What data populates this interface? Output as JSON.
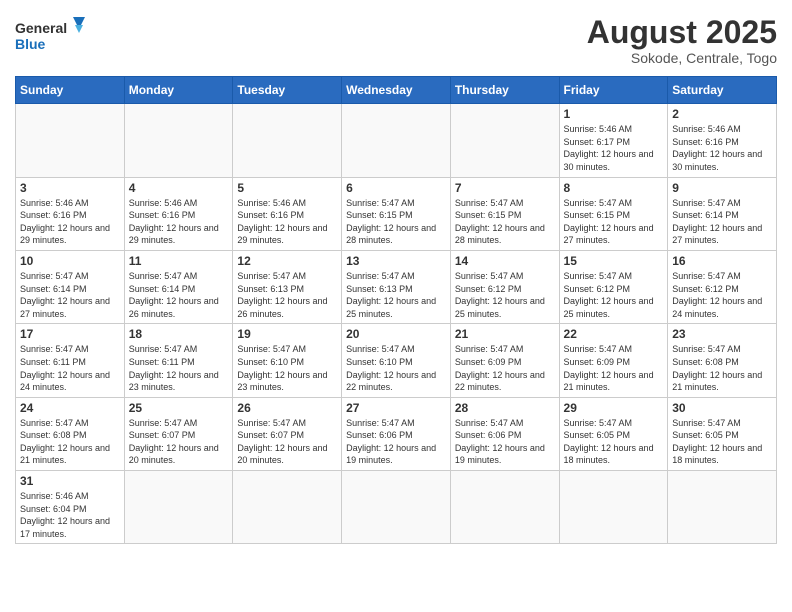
{
  "header": {
    "logo_general": "General",
    "logo_blue": "Blue",
    "main_title": "August 2025",
    "subtitle": "Sokode, Centrale, Togo"
  },
  "weekdays": [
    "Sunday",
    "Monday",
    "Tuesday",
    "Wednesday",
    "Thursday",
    "Friday",
    "Saturday"
  ],
  "days": [
    {
      "date": "",
      "info": ""
    },
    {
      "date": "",
      "info": ""
    },
    {
      "date": "",
      "info": ""
    },
    {
      "date": "",
      "info": ""
    },
    {
      "date": "",
      "info": ""
    },
    {
      "date": "1",
      "info": "Sunrise: 5:46 AM\nSunset: 6:17 PM\nDaylight: 12 hours and 30 minutes."
    },
    {
      "date": "2",
      "info": "Sunrise: 5:46 AM\nSunset: 6:16 PM\nDaylight: 12 hours and 30 minutes."
    },
    {
      "date": "3",
      "info": "Sunrise: 5:46 AM\nSunset: 6:16 PM\nDaylight: 12 hours and 29 minutes."
    },
    {
      "date": "4",
      "info": "Sunrise: 5:46 AM\nSunset: 6:16 PM\nDaylight: 12 hours and 29 minutes."
    },
    {
      "date": "5",
      "info": "Sunrise: 5:46 AM\nSunset: 6:16 PM\nDaylight: 12 hours and 29 minutes."
    },
    {
      "date": "6",
      "info": "Sunrise: 5:47 AM\nSunset: 6:15 PM\nDaylight: 12 hours and 28 minutes."
    },
    {
      "date": "7",
      "info": "Sunrise: 5:47 AM\nSunset: 6:15 PM\nDaylight: 12 hours and 28 minutes."
    },
    {
      "date": "8",
      "info": "Sunrise: 5:47 AM\nSunset: 6:15 PM\nDaylight: 12 hours and 27 minutes."
    },
    {
      "date": "9",
      "info": "Sunrise: 5:47 AM\nSunset: 6:14 PM\nDaylight: 12 hours and 27 minutes."
    },
    {
      "date": "10",
      "info": "Sunrise: 5:47 AM\nSunset: 6:14 PM\nDaylight: 12 hours and 27 minutes."
    },
    {
      "date": "11",
      "info": "Sunrise: 5:47 AM\nSunset: 6:14 PM\nDaylight: 12 hours and 26 minutes."
    },
    {
      "date": "12",
      "info": "Sunrise: 5:47 AM\nSunset: 6:13 PM\nDaylight: 12 hours and 26 minutes."
    },
    {
      "date": "13",
      "info": "Sunrise: 5:47 AM\nSunset: 6:13 PM\nDaylight: 12 hours and 25 minutes."
    },
    {
      "date": "14",
      "info": "Sunrise: 5:47 AM\nSunset: 6:12 PM\nDaylight: 12 hours and 25 minutes."
    },
    {
      "date": "15",
      "info": "Sunrise: 5:47 AM\nSunset: 6:12 PM\nDaylight: 12 hours and 25 minutes."
    },
    {
      "date": "16",
      "info": "Sunrise: 5:47 AM\nSunset: 6:12 PM\nDaylight: 12 hours and 24 minutes."
    },
    {
      "date": "17",
      "info": "Sunrise: 5:47 AM\nSunset: 6:11 PM\nDaylight: 12 hours and 24 minutes."
    },
    {
      "date": "18",
      "info": "Sunrise: 5:47 AM\nSunset: 6:11 PM\nDaylight: 12 hours and 23 minutes."
    },
    {
      "date": "19",
      "info": "Sunrise: 5:47 AM\nSunset: 6:10 PM\nDaylight: 12 hours and 23 minutes."
    },
    {
      "date": "20",
      "info": "Sunrise: 5:47 AM\nSunset: 6:10 PM\nDaylight: 12 hours and 22 minutes."
    },
    {
      "date": "21",
      "info": "Sunrise: 5:47 AM\nSunset: 6:09 PM\nDaylight: 12 hours and 22 minutes."
    },
    {
      "date": "22",
      "info": "Sunrise: 5:47 AM\nSunset: 6:09 PM\nDaylight: 12 hours and 21 minutes."
    },
    {
      "date": "23",
      "info": "Sunrise: 5:47 AM\nSunset: 6:08 PM\nDaylight: 12 hours and 21 minutes."
    },
    {
      "date": "24",
      "info": "Sunrise: 5:47 AM\nSunset: 6:08 PM\nDaylight: 12 hours and 21 minutes."
    },
    {
      "date": "25",
      "info": "Sunrise: 5:47 AM\nSunset: 6:07 PM\nDaylight: 12 hours and 20 minutes."
    },
    {
      "date": "26",
      "info": "Sunrise: 5:47 AM\nSunset: 6:07 PM\nDaylight: 12 hours and 20 minutes."
    },
    {
      "date": "27",
      "info": "Sunrise: 5:47 AM\nSunset: 6:06 PM\nDaylight: 12 hours and 19 minutes."
    },
    {
      "date": "28",
      "info": "Sunrise: 5:47 AM\nSunset: 6:06 PM\nDaylight: 12 hours and 19 minutes."
    },
    {
      "date": "29",
      "info": "Sunrise: 5:47 AM\nSunset: 6:05 PM\nDaylight: 12 hours and 18 minutes."
    },
    {
      "date": "30",
      "info": "Sunrise: 5:47 AM\nSunset: 6:05 PM\nDaylight: 12 hours and 18 minutes."
    },
    {
      "date": "31",
      "info": "Sunrise: 5:46 AM\nSunset: 6:04 PM\nDaylight: 12 hours and 17 minutes."
    },
    {
      "date": "",
      "info": ""
    },
    {
      "date": "",
      "info": ""
    },
    {
      "date": "",
      "info": ""
    },
    {
      "date": "",
      "info": ""
    },
    {
      "date": "",
      "info": ""
    },
    {
      "date": "",
      "info": ""
    }
  ]
}
